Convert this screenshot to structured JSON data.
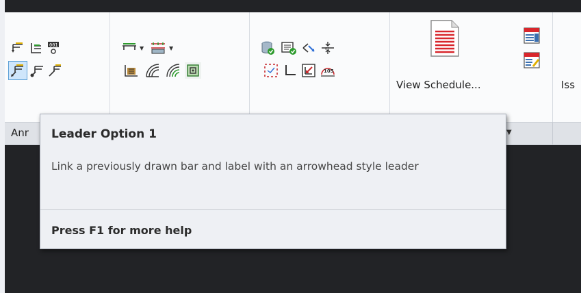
{
  "ribbon": {
    "panel_title_clipped": "Anr",
    "view_schedule_label": "View Schedule...",
    "issue_label_clipped": "Iss"
  },
  "icons": {
    "row1": [
      "leader-down-icon",
      "leader-multi-icon",
      "label-01-icon",
      "line-style-icon",
      "rebar-hatch-icon",
      "database-check-icon",
      "form-check-icon",
      "extend-arrows-icon",
      "split-bar-icon"
    ],
    "row2": [
      "leader-option-1-icon",
      "leader-dot-icon",
      "leader-slash-icon",
      "bar-chart-icon",
      "arc-bars-icon",
      "arc-bars-green-icon",
      "square-target-icon",
      "dashed-box-icon",
      "corner-l-icon",
      "arrow-box-icon",
      "dimension-105-icon"
    ]
  },
  "tooltip": {
    "title": "Leader Option 1",
    "description": "Link a previously drawn bar and label with an arrowhead style leader",
    "help": "Press F1 for more help"
  },
  "colors": {
    "accent": "#5a9fd6",
    "tooltip_bg": "#eef0f4",
    "dark_bg": "#222326"
  }
}
